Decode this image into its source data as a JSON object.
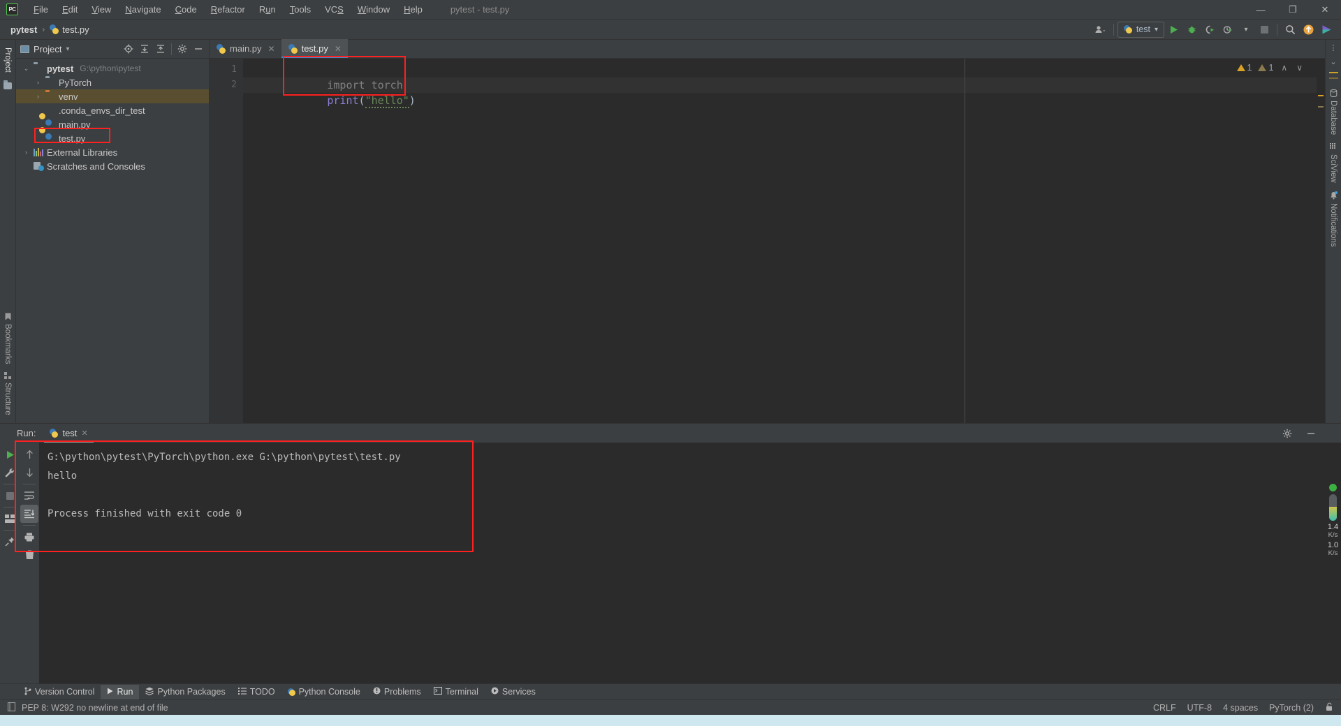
{
  "window": {
    "title": "pytest - test.py",
    "logo": "pycharm-logo",
    "minimize": "—",
    "maximize": "❐",
    "close": "✕"
  },
  "menubar": {
    "items": [
      {
        "label": "File",
        "mnemonic": "F"
      },
      {
        "label": "Edit",
        "mnemonic": "E"
      },
      {
        "label": "View",
        "mnemonic": "V"
      },
      {
        "label": "Navigate",
        "mnemonic": "N"
      },
      {
        "label": "Code",
        "mnemonic": "C"
      },
      {
        "label": "Refactor",
        "mnemonic": "R"
      },
      {
        "label": "Run",
        "mnemonic": "u"
      },
      {
        "label": "Tools",
        "mnemonic": "T"
      },
      {
        "label": "VCS",
        "mnemonic": "S"
      },
      {
        "label": "Window",
        "mnemonic": "W"
      },
      {
        "label": "Help",
        "mnemonic": "H"
      }
    ]
  },
  "navbar": {
    "breadcrumbs": [
      {
        "label": "pytest",
        "icon": "project-icon"
      },
      {
        "label": "test.py",
        "icon": "python-file-icon"
      }
    ],
    "separator": "›",
    "run_config": {
      "label": "test",
      "icon": "python-icon",
      "caret": "▾"
    },
    "icons": [
      {
        "name": "user-accounts-icon",
        "glyph": "👥"
      },
      {
        "name": "run-icon",
        "glyph": "▶"
      },
      {
        "name": "debug-icon",
        "glyph": "🐞"
      },
      {
        "name": "run-coverage-icon",
        "glyph": "◔"
      },
      {
        "name": "profile-icon",
        "glyph": "◴"
      },
      {
        "name": "stop-icon",
        "glyph": "■"
      },
      {
        "name": "search-everywhere-icon",
        "glyph": "🔍"
      },
      {
        "name": "update-project-icon",
        "glyph": "↑"
      },
      {
        "name": "ide-feature-icon",
        "glyph": "▶"
      }
    ]
  },
  "project_panel": {
    "title": "Project",
    "caret": "▾",
    "actions": [
      {
        "name": "select-opened-file-icon",
        "glyph": "⌖"
      },
      {
        "name": "expand-all-icon",
        "glyph": "⇲"
      },
      {
        "name": "collapse-all-icon",
        "glyph": "⇱"
      },
      {
        "name": "settings-gear-icon",
        "glyph": "⚙"
      },
      {
        "name": "hide-panel-icon",
        "glyph": "—"
      }
    ],
    "tree": [
      {
        "label": "pytest",
        "path": "G:\\python\\pytest",
        "icon": "folder-icon",
        "arrow": "⌄",
        "depth": 0,
        "bold": true,
        "selected": false,
        "highlighted": false
      },
      {
        "label": "PyTorch",
        "path": "",
        "icon": "folder-icon",
        "arrow": "›",
        "depth": 1,
        "bold": false,
        "selected": false,
        "highlighted": false
      },
      {
        "label": "venv",
        "path": "",
        "icon": "folder-orange-icon",
        "arrow": "›",
        "depth": 1,
        "bold": false,
        "selected": true,
        "highlighted": false
      },
      {
        "label": ".conda_envs_dir_test",
        "path": "",
        "icon": "text-file-icon",
        "arrow": "",
        "depth": 2,
        "bold": false,
        "selected": false,
        "highlighted": false
      },
      {
        "label": "main.py",
        "path": "",
        "icon": "python-file-icon",
        "arrow": "",
        "depth": 2,
        "bold": false,
        "selected": false,
        "highlighted": false
      },
      {
        "label": "test.py",
        "path": "",
        "icon": "python-file-icon",
        "arrow": "",
        "depth": 2,
        "bold": false,
        "selected": false,
        "highlighted": true
      },
      {
        "label": "External Libraries",
        "path": "",
        "icon": "libraries-icon",
        "arrow": "›",
        "depth": 0,
        "bold": false,
        "selected": false,
        "highlighted": false
      },
      {
        "label": "Scratches and Consoles",
        "path": "",
        "icon": "scratches-icon",
        "arrow": "",
        "depth": 1,
        "bold": false,
        "selected": false,
        "highlighted": false
      }
    ]
  },
  "editor": {
    "tabs": [
      {
        "label": "main.py",
        "icon": "python-file-icon",
        "active": false,
        "close": "✕"
      },
      {
        "label": "test.py",
        "icon": "python-file-icon",
        "active": true,
        "close": "✕"
      }
    ],
    "line_numbers": [
      "1",
      "2"
    ],
    "lines": [
      {
        "n": "1",
        "tokens": [
          {
            "t": "import torch",
            "c": "gray"
          }
        ]
      },
      {
        "n": "2",
        "tokens": [
          {
            "t": "print",
            "c": "func"
          },
          {
            "t": "(",
            "c": "paren"
          },
          {
            "t": "\"hello\"",
            "c": "str"
          },
          {
            "t": ")",
            "c": "paren"
          }
        ]
      }
    ],
    "inspections": {
      "warning_count": "1",
      "weak_warning_count": "1",
      "prev": "∧",
      "next": "∨"
    }
  },
  "right_strip": {
    "items": [
      {
        "label": "Database",
        "icon": "database-icon"
      },
      {
        "label": "SciView",
        "icon": "sciview-icon"
      },
      {
        "label": "Notifications",
        "icon": "bell-icon"
      }
    ],
    "more": "⋮",
    "collapse": "⌄"
  },
  "left_strip": {
    "top": [
      {
        "label": "Project",
        "icon": "project-icon"
      }
    ],
    "bottom": [
      {
        "label": "Bookmarks",
        "icon": "bookmark-icon"
      },
      {
        "label": "Structure",
        "icon": "structure-icon"
      }
    ]
  },
  "run_panel": {
    "label": "Run:",
    "tab": {
      "label": "test",
      "icon": "python-icon",
      "close": "✕"
    },
    "header_icons": [
      {
        "name": "console-settings-icon",
        "glyph": "⚙"
      },
      {
        "name": "hide-console-icon",
        "glyph": "—"
      }
    ],
    "tools_left": [
      {
        "name": "rerun-icon",
        "glyph": "▶"
      },
      {
        "name": "edit-configuration-icon",
        "glyph": "🔧"
      },
      {
        "name": "stop-process-icon",
        "glyph": "■"
      },
      {
        "name": "layout-icon",
        "glyph": "▤"
      },
      {
        "name": "pin-tab-icon",
        "glyph": "📌"
      }
    ],
    "tools_right": [
      {
        "name": "up-arrow-icon",
        "glyph": "↑"
      },
      {
        "name": "down-arrow-icon",
        "glyph": "↓"
      },
      {
        "name": "soft-wrap-icon",
        "glyph": "↵"
      },
      {
        "name": "scroll-to-end-icon",
        "glyph": "↧"
      },
      {
        "name": "print-icon",
        "glyph": "🖨"
      },
      {
        "name": "clear-all-icon",
        "glyph": "🗑"
      }
    ],
    "console": [
      {
        "text": "G:\\python\\pytest\\PyTorch\\python.exe G:\\python\\pytest\\test.py",
        "kind": "cmd"
      },
      {
        "text": "hello",
        "kind": "out"
      },
      {
        "text": "",
        "kind": "blank"
      },
      {
        "text": "Process finished with exit code 0",
        "kind": "out"
      }
    ]
  },
  "tool_window_bar": {
    "items": [
      {
        "label": "Version Control",
        "icon": "branch-icon",
        "active": false
      },
      {
        "label": "Run",
        "icon": "run-icon",
        "active": true
      },
      {
        "label": "Python Packages",
        "icon": "packages-icon",
        "active": false
      },
      {
        "label": "TODO",
        "icon": "todo-icon",
        "active": false
      },
      {
        "label": "Python Console",
        "icon": "python-icon",
        "active": false
      },
      {
        "label": "Problems",
        "icon": "problems-icon",
        "active": false
      },
      {
        "label": "Terminal",
        "icon": "terminal-icon",
        "active": false
      },
      {
        "label": "Services",
        "icon": "services-icon",
        "active": false
      }
    ]
  },
  "statusbar": {
    "message": "PEP 8: W292 no newline at end of file",
    "message_icon": "book-icon",
    "right": [
      {
        "name": "line-separator",
        "label": "CRLF"
      },
      {
        "name": "file-encoding",
        "label": "UTF-8"
      },
      {
        "name": "indent-size",
        "label": "4 spaces"
      },
      {
        "name": "python-interpreter",
        "label": "PyTorch (2)"
      },
      {
        "name": "lock-icon",
        "label": "🔓"
      }
    ]
  },
  "network_meter": {
    "status": "green",
    "upload": {
      "value": "1.4",
      "unit": "K/s",
      "arrow": "↑"
    },
    "download": {
      "value": "1.0",
      "unit": "K/s",
      "arrow": "↓"
    }
  },
  "colors": {
    "bg_panel": "#3c3f41",
    "bg_editor": "#2b2b2b",
    "accent_blue": "#4a88c7",
    "annotation_red": "#ff2020",
    "selection_amber": "#5a4e30",
    "string_green": "#6a8759",
    "func_purple": "#8a7fd4",
    "comment_gray": "#808080"
  }
}
